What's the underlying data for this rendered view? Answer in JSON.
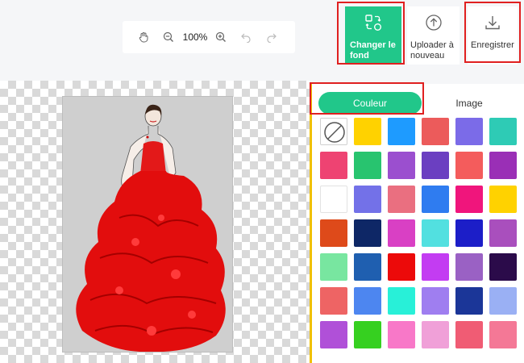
{
  "toolbar": {
    "zoom_value": "100%",
    "actions": {
      "change_bg": {
        "label": "Changer le fond",
        "icon": "change-background-icon",
        "color": "#21c78a"
      },
      "upload": {
        "label": "Uploader à nouveau",
        "icon": "upload-icon"
      },
      "save": {
        "label": "Enregistrer",
        "icon": "download-icon"
      }
    }
  },
  "panel": {
    "tabs": [
      "Couleur",
      "Image"
    ],
    "active_tab": "Couleur",
    "accent": "#21c78a",
    "swatches": [
      [
        "none",
        "#ffd200",
        "#1e9bff",
        "#ec5b5b",
        "#7b6be8",
        "#2ecbb5"
      ],
      [
        "#ee4372",
        "#28c46f",
        "#9b4fcf",
        "#6b3fc1",
        "#f45c5c",
        "#9a2fb6"
      ],
      [
        "#ffffff",
        "#7371e8",
        "#ea6f80",
        "#2f7cf0",
        "#f0157c",
        "#ffd200"
      ],
      [
        "#de4a1a",
        "#0e2766",
        "#d940c4",
        "#52e0e0",
        "#1c1ec8",
        "#a94fbd"
      ],
      [
        "#78e6a0",
        "#1f5fb0",
        "#ec0a0a",
        "#c33cf2",
        "#9a61c4",
        "#2b0b4a"
      ],
      [
        "#ee6464",
        "#4d86f0",
        "#28f0d8",
        "#9f7ef0",
        "#1b3698",
        "#9ab0f4"
      ],
      [
        "#b050d8",
        "#36d020",
        "#f878c8",
        "#f0a0d8",
        "#f05c74",
        "#f47896"
      ]
    ]
  }
}
